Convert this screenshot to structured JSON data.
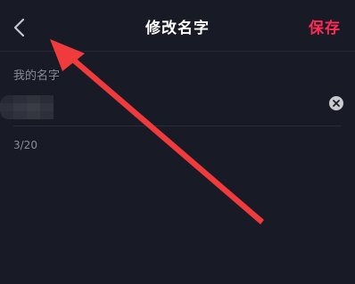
{
  "header": {
    "back_icon": "chevron-left-icon",
    "title": "修改名字",
    "save_label": "保存"
  },
  "form": {
    "field_label": "我的名字",
    "name_value_obscured": true,
    "clear_icon": "close-circle-icon",
    "char_count": "3/20"
  },
  "colors": {
    "background": "#181a25",
    "accent": "#fe2c55",
    "secondary_text": "#8a8b93",
    "annotation_arrow": "#ef3b3b"
  },
  "annotation": {
    "type": "arrow",
    "points_to": "back-button"
  }
}
